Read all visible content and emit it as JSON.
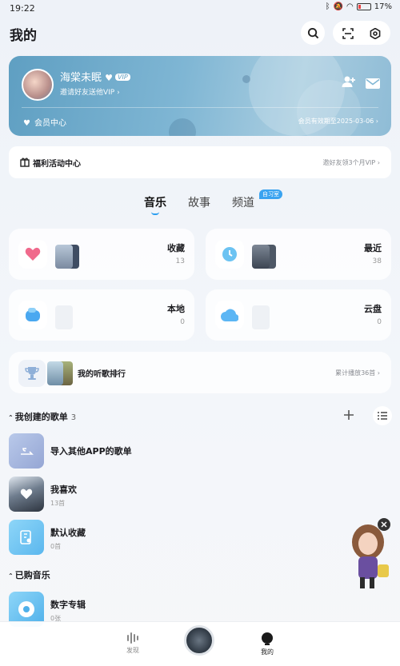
{
  "status": {
    "time": "19:22",
    "battery": "17%"
  },
  "header": {
    "title": "我的"
  },
  "profile": {
    "username": "海棠未眠",
    "vip_badge": "VIP",
    "invite_text": "邀请好友送他VIP ›",
    "vip_center": "会员中心",
    "vip_expiry": "会员有效期至2025-03-06 ›"
  },
  "welfare": {
    "title": "福利活动中心",
    "hint": "邀好友领3个月VIP ›"
  },
  "tabs": [
    {
      "label": "音乐"
    },
    {
      "label": "故事"
    },
    {
      "label": "频道",
      "badge": "自习室"
    }
  ],
  "tiles": [
    {
      "name": "收藏",
      "count": "13"
    },
    {
      "name": "最近",
      "count": "38"
    },
    {
      "name": "本地",
      "count": "0"
    },
    {
      "name": "云盘",
      "count": "0"
    }
  ],
  "rank": {
    "title": "我的听歌排行",
    "hint": "累计播放36首 ›"
  },
  "created_playlists": {
    "title": "我创建的歌单",
    "count": "3",
    "items": [
      {
        "name": "导入其他APP的歌单",
        "count": ""
      },
      {
        "name": "我喜欢",
        "count": "13首"
      },
      {
        "name": "默认收藏",
        "count": "0首"
      }
    ]
  },
  "purchased": {
    "title": "已购音乐",
    "items": [
      {
        "name": "数字专辑",
        "count": "0张"
      }
    ]
  },
  "nav": [
    {
      "label": "发现"
    },
    {
      "label": "我的"
    }
  ],
  "colors": {
    "accent": "#2c9ef0",
    "vip_card": "#6aa8c9"
  }
}
